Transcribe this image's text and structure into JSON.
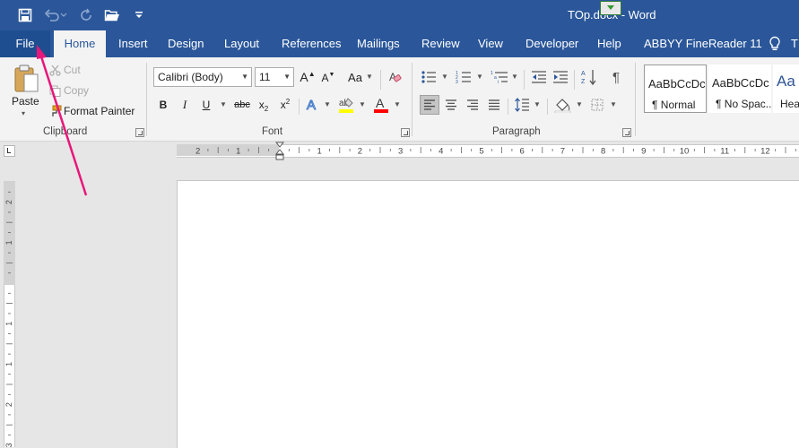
{
  "window": {
    "document_title": "TOp.docx - Word"
  },
  "quick_access": {
    "icons": [
      "save-icon",
      "undo-icon",
      "redo-icon",
      "open-folder-icon",
      "customize-qat-icon"
    ]
  },
  "tabs": [
    {
      "label": "File"
    },
    {
      "label": "Home"
    },
    {
      "label": "Insert"
    },
    {
      "label": "Design"
    },
    {
      "label": "Layout"
    },
    {
      "label": "References"
    },
    {
      "label": "Mailings"
    },
    {
      "label": "Review"
    },
    {
      "label": "View"
    },
    {
      "label": "Developer"
    },
    {
      "label": "Help"
    },
    {
      "label": "ABBYY FineReader 11"
    }
  ],
  "tell_me": {
    "label": "T"
  },
  "clipboard": {
    "paste": "Paste",
    "cut": "Cut",
    "copy": "Copy",
    "format_painter": "Format Painter",
    "group_label": "Clipboard"
  },
  "font": {
    "family": "Calibri (Body)",
    "size": "11",
    "group_label": "Font",
    "change_case": "Aa"
  },
  "paragraph": {
    "group_label": "Paragraph"
  },
  "styles": {
    "items": [
      {
        "sample": "AaBbCcDc",
        "name": "¶ Normal"
      },
      {
        "sample": "AaBbCcDc",
        "name": "¶ No Spac..."
      },
      {
        "sample": "Aa",
        "name": "Hea"
      }
    ]
  },
  "ruler": {
    "horizontal_labels": [
      "2",
      "1",
      "1",
      "1",
      "2",
      "3",
      "4",
      "5",
      "6",
      "7",
      "8",
      "9",
      "10",
      "11",
      "12"
    ],
    "vertical_labels": [
      "2",
      "1",
      "1",
      "1",
      "2",
      "3"
    ]
  },
  "colors": {
    "ribbon_blue": "#2b579a",
    "highlight_yellow": "#ffff00",
    "font_color_red": "#ff0000",
    "annotation_arrow": "#e8177a"
  }
}
